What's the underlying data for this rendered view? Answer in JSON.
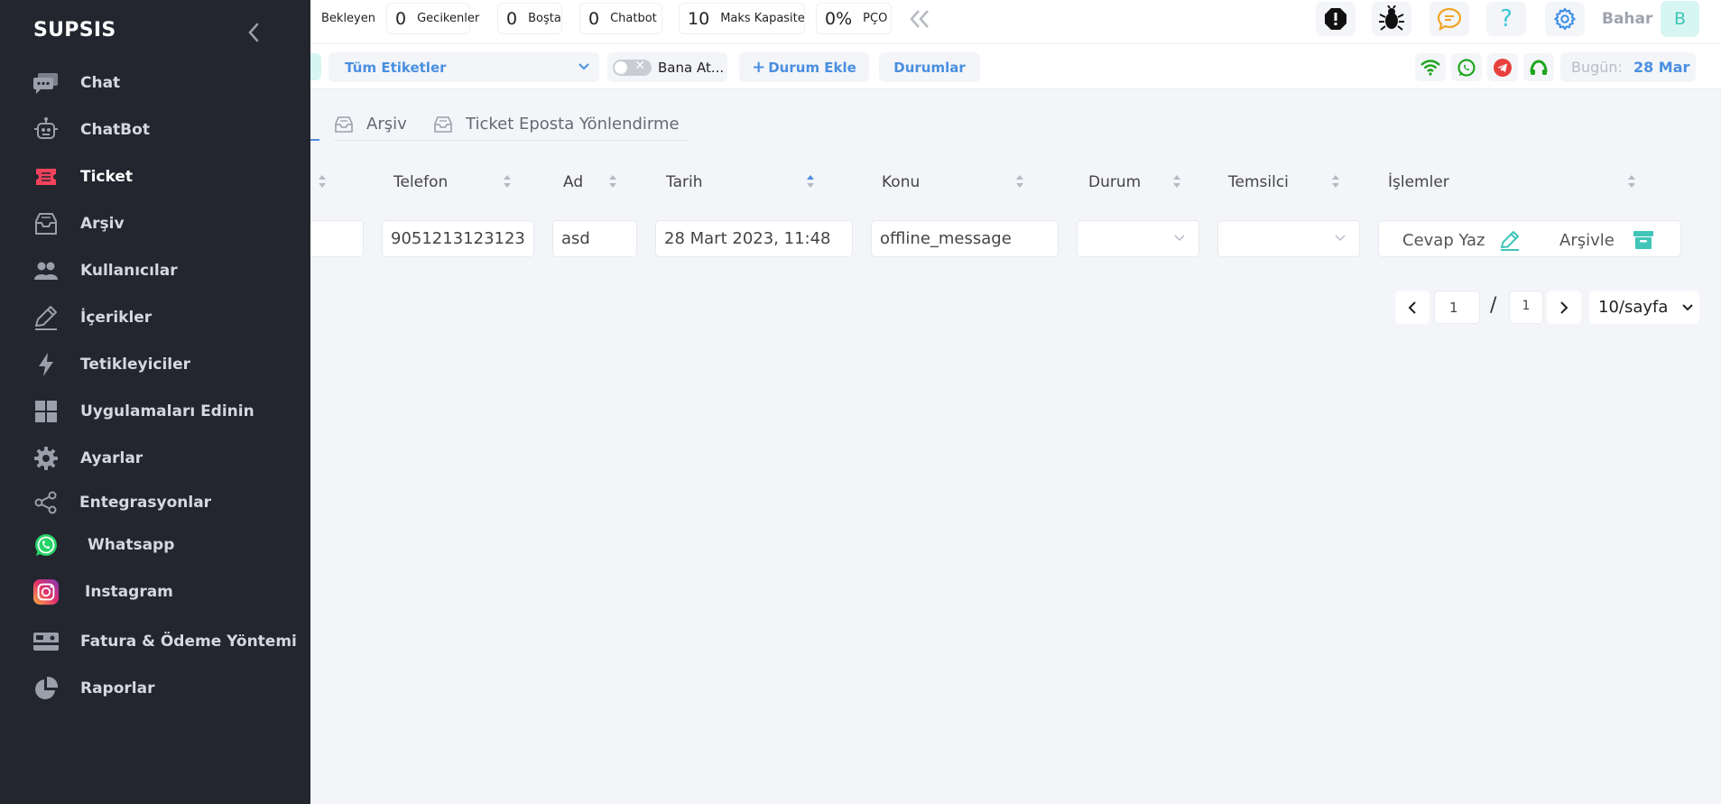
{
  "sidebar": {
    "brand": "SUPSIS",
    "items": [
      {
        "label": "Chat",
        "icon": "chat-icon"
      },
      {
        "label": "ChatBot",
        "icon": "chatbot-icon"
      },
      {
        "label": "Ticket",
        "icon": "ticket-icon"
      },
      {
        "label": "Arşiv",
        "icon": "archive-icon"
      },
      {
        "label": "Kullanıcılar",
        "icon": "users-icon"
      },
      {
        "label": "İçerikler",
        "icon": "edit-icon"
      },
      {
        "label": "Tetikleyiciler",
        "icon": "bolt-icon"
      },
      {
        "label": "Uygulamaları Edinin",
        "icon": "apps-grid-icon"
      },
      {
        "label": "Ayarlar",
        "icon": "gear-icon"
      },
      {
        "label": "Entegrasyonlar",
        "icon": "share-icon"
      },
      {
        "label": "Whatsapp",
        "icon": "whatsapp-icon"
      },
      {
        "label": "Instagram",
        "icon": "instagram-icon"
      },
      {
        "label": "Fatura & Ödeme Yöntemi",
        "icon": "credit-card-icon"
      },
      {
        "label": "Raporlar",
        "icon": "pie-chart-icon"
      }
    ],
    "active": "Ticket"
  },
  "topbar": {
    "stats": [
      {
        "value": "",
        "label": "Bekleyen"
      },
      {
        "value": "0",
        "label": "Gecikenler"
      },
      {
        "value": "0",
        "label": "Boşta"
      },
      {
        "value": "0",
        "label": "Chatbot"
      },
      {
        "value": "10",
        "label": "Maks Kapasite"
      },
      {
        "value": "0%",
        "label": "PÇO"
      }
    ],
    "icons": [
      "alert-icon",
      "bug-icon",
      "feedback-icon",
      "help-icon",
      "settings-icon"
    ],
    "user_name": "Bahar",
    "avatar_initial": "B"
  },
  "filterbar": {
    "tags_select": "Tüm Etiketler",
    "assign_toggle_label": "Bana At...",
    "add_status_label": "Durum Ekle",
    "statuses_label": "Durumlar",
    "channels": [
      "wifi-icon",
      "whatsapp-icon",
      "telegram-icon",
      "webchat-icon"
    ],
    "today_label": "Bugün:",
    "today_value": "28 Mar"
  },
  "tabs": [
    {
      "label": "Arşiv",
      "icon": "inbox-icon"
    },
    {
      "label": "Ticket Eposta Yönlendirme",
      "icon": "inbox-icon"
    }
  ],
  "table": {
    "columns": [
      "Telefon",
      "Ad",
      "Tarih",
      "Konu",
      "Durum",
      "Temsilci",
      "İşlemler"
    ],
    "rows": [
      {
        "telefon": "9051213123123",
        "ad": "asd",
        "tarih": "28 Mart 2023, 11:48",
        "konu": "offline_message",
        "durum": "",
        "temsilci": "",
        "reply_label": "Cevap Yaz",
        "archive_label": "Arşivle"
      }
    ]
  },
  "pagination": {
    "current_page": "1",
    "total_pages": "1",
    "separator": "/",
    "page_size": "10/sayfa"
  },
  "colors": {
    "sidebar_bg": "#23252f",
    "accent_blue": "#4a8fe0",
    "accent_teal": "#40c5b8",
    "ticket_red": "#f0435b"
  }
}
